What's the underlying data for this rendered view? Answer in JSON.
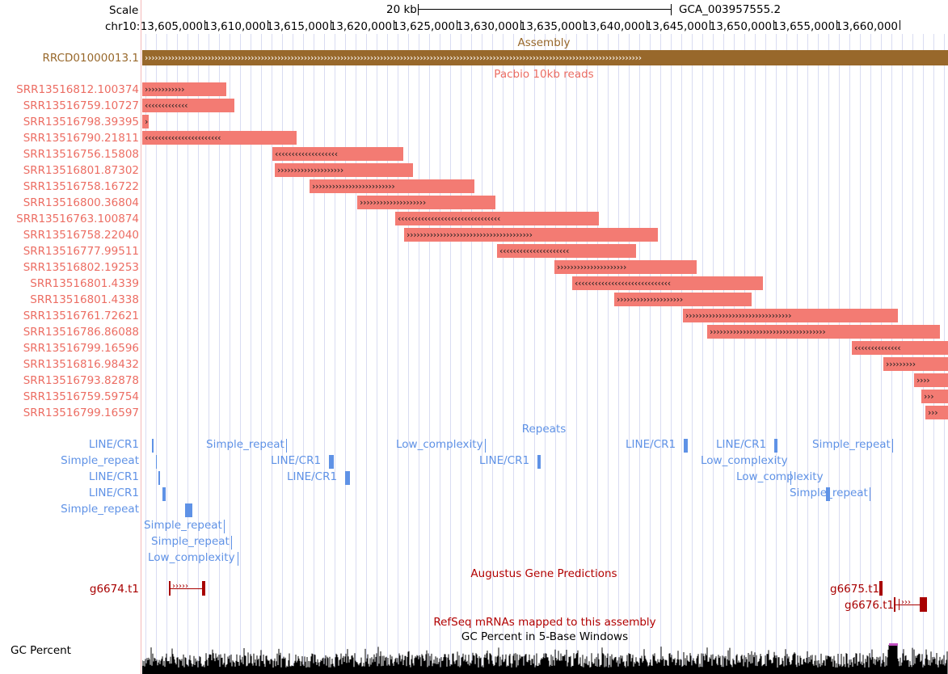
{
  "browser": {
    "scale": {
      "label": "Scale",
      "size": "20 kb",
      "assembly_name": "GCA_003957555.2"
    },
    "ruler": {
      "chrom_label": "chr10:",
      "positions": [
        "13,605,000",
        "13,610,000",
        "13,615,000",
        "13,620,000",
        "13,625,000",
        "13,630,000",
        "13,635,000",
        "13,640,000",
        "13,645,000",
        "13,650,000",
        "13,655,000",
        "13,660,000"
      ]
    },
    "colors": {
      "assembly": "#98682b",
      "reads": "#f37b73",
      "reads_text": "#ec6d63",
      "repeats": "#5f92e6",
      "genes": "#a80000",
      "title_red": "#b20000"
    },
    "tracks": {
      "assembly": {
        "title": "Assembly",
        "item": "RRCD01000013.1",
        "strand": "+"
      },
      "pacbio": {
        "title": "Pacbio 10kb reads",
        "reads": [
          {
            "name": "SRR13516812.100374",
            "strand": "+"
          },
          {
            "name": "SRR13516759.10727",
            "strand": "-"
          },
          {
            "name": "SRR13516798.39395",
            "strand": "+"
          },
          {
            "name": "SRR13516790.21811",
            "strand": "-"
          },
          {
            "name": "SRR13516756.15808",
            "strand": "-"
          },
          {
            "name": "SRR13516801.87302",
            "strand": "+"
          },
          {
            "name": "SRR13516758.16722",
            "strand": "+"
          },
          {
            "name": "SRR13516800.36804",
            "strand": "+"
          },
          {
            "name": "SRR13516763.100874",
            "strand": "-"
          },
          {
            "name": "SRR13516758.22040",
            "strand": "+"
          },
          {
            "name": "SRR13516777.99511",
            "strand": "-"
          },
          {
            "name": "SRR13516802.19253",
            "strand": "+"
          },
          {
            "name": "SRR13516801.4339",
            "strand": "-"
          },
          {
            "name": "SRR13516801.4338",
            "strand": "+"
          },
          {
            "name": "SRR13516761.72621",
            "strand": "+"
          },
          {
            "name": "SRR13516786.86088",
            "strand": "+"
          },
          {
            "name": "SRR13516799.16596",
            "strand": "-"
          },
          {
            "name": "SRR13516816.98432",
            "strand": "+"
          },
          {
            "name": "SRR13516793.82878",
            "strand": "+"
          },
          {
            "name": "SRR13516759.59754",
            "strand": "+"
          },
          {
            "name": "SRR13516799.16597",
            "strand": "+"
          }
        ]
      },
      "repeats": {
        "title": "Repeats",
        "items": [
          {
            "name": "LINE/CR1"
          },
          {
            "name": "Simple_repeat"
          },
          {
            "name": "Low_complexity"
          },
          {
            "name": "LINE/CR1"
          },
          {
            "name": "LINE/CR1"
          },
          {
            "name": "Simple_repeat"
          },
          {
            "name": "LINE/CR1"
          },
          {
            "name": "LINE/CR1"
          },
          {
            "name": "LINE/CR1"
          },
          {
            "name": "Low_complexity"
          },
          {
            "name": "LINE/CR1"
          },
          {
            "name": "LINE/CR1"
          },
          {
            "name": "Low_complexity"
          },
          {
            "name": "LINE/CR1"
          },
          {
            "name": "Simple_repeat"
          },
          {
            "name": "Simple_repeat"
          },
          {
            "name": "Simple_repeat"
          },
          {
            "name": "Simple_repeat"
          },
          {
            "name": "Low_complexity"
          }
        ]
      },
      "augustus": {
        "title": "Augustus Gene Predictions",
        "genes": [
          "g6674.t1",
          "g6675.t1",
          "g6676.t1"
        ]
      },
      "refseq": {
        "title": "RefSeq mRNAs mapped to this assembly"
      },
      "gc": {
        "title": "GC Percent in 5-Base Windows",
        "label": "GC Percent"
      }
    }
  }
}
